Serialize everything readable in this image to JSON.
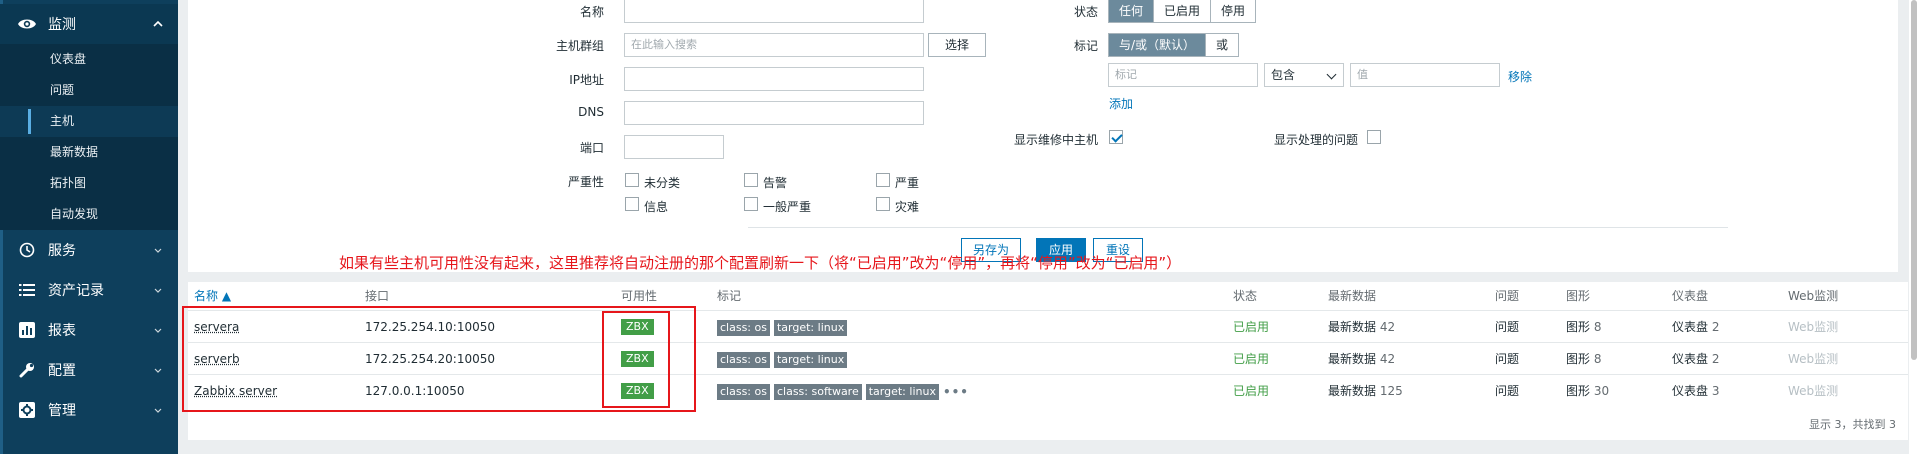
{
  "sidebar": {
    "monitor": {
      "label": "监测",
      "icon": "eye-icon"
    },
    "submenu": [
      "仪表盘",
      "问题",
      "主机",
      "最新数据",
      "拓扑图",
      "自动发现"
    ],
    "services": {
      "label": "服务",
      "icon": "services-icon"
    },
    "inventory": {
      "label": "资产记录",
      "icon": "list-icon"
    },
    "reports": {
      "label": "报表",
      "icon": "chart-icon"
    },
    "config": {
      "label": "配置",
      "icon": "wrench-icon"
    },
    "admin": {
      "label": "管理",
      "icon": "gear-icon"
    }
  },
  "filter": {
    "name_label": "名称",
    "hostgroup_label": "主机群组",
    "hostgroup_placeholder": "在此输入搜索",
    "select_btn": "选择",
    "ip_label": "IP地址",
    "dns_label": "DNS",
    "port_label": "端口",
    "severity_label": "严重性",
    "severities": [
      "未分类",
      "告警",
      "严重",
      "信息",
      "一般严重",
      "灾难"
    ],
    "status_label": "状态",
    "status_options": [
      "任何",
      "已启用",
      "停用"
    ],
    "tags_label": "标记",
    "tag_mode_options": [
      "与/或（默认）",
      "或"
    ],
    "tag_placeholder": "标记",
    "tag_operator": "包含",
    "tag_value_placeholder": "值",
    "remove_link": "移除",
    "add_link": "添加",
    "maintenance_label": "显示维修中主机",
    "suppressed_label": "显示处理的问题",
    "save_as_btn": "另存为",
    "apply_btn": "应用",
    "reset_btn": "重设"
  },
  "annotation": "如果有些主机可用性没有起来，这里推荐将自动注册的那个配置刷新一下（将“已启用”改为“停用”，再将“停用”改为“已启用”）",
  "table": {
    "headers": [
      "名称 ▲",
      "接口",
      "可用性",
      "标记",
      "状态",
      "最新数据",
      "问题",
      "图形",
      "仪表盘",
      "Web监测"
    ],
    "rows": [
      {
        "name": "servera",
        "interface": "172.25.254.10:10050",
        "availability": "ZBX",
        "tags": [
          "class: os",
          "target: linux"
        ],
        "status": "已启用",
        "latest": "最新数据",
        "latest_count": "42",
        "problems": "问题",
        "graphs": "图形",
        "graphs_count": "8",
        "dashboards": "仪表盘",
        "dashboards_count": "2",
        "web": "Web监测"
      },
      {
        "name": "serverb",
        "interface": "172.25.254.20:10050",
        "availability": "ZBX",
        "tags": [
          "class: os",
          "target: linux"
        ],
        "status": "已启用",
        "latest": "最新数据",
        "latest_count": "42",
        "problems": "问题",
        "graphs": "图形",
        "graphs_count": "8",
        "dashboards": "仪表盘",
        "dashboards_count": "2",
        "web": "Web监测"
      },
      {
        "name": "Zabbix server",
        "interface": "127.0.0.1:10050",
        "availability": "ZBX",
        "tags": [
          "class: os",
          "class: software",
          "target: linux"
        ],
        "status": "已启用",
        "latest": "最新数据",
        "latest_count": "125",
        "problems": "问题",
        "graphs": "图形",
        "graphs_count": "30",
        "dashboards": "仪表盘",
        "dashboards_count": "3",
        "web": "Web监测"
      }
    ],
    "footer": "显示 3，共找到 3"
  }
}
